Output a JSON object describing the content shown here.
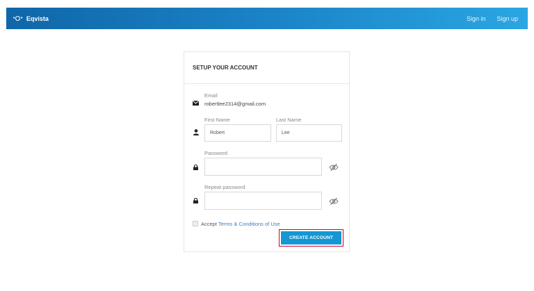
{
  "header": {
    "brand": "Eqvista",
    "nav": {
      "sign_in": "Sign in",
      "sign_up": "Sign up"
    }
  },
  "form": {
    "title": "SETUP YOUR ACCOUNT",
    "email": {
      "label": "Email",
      "value": "robertlee2314@gmail.com"
    },
    "first_name": {
      "label": "First Name",
      "value": "Robert"
    },
    "last_name": {
      "label": "Last Name",
      "value": "Lee"
    },
    "password": {
      "label": "Password",
      "value": ""
    },
    "repeat_password": {
      "label": "Repeat password",
      "value": ""
    },
    "accept": {
      "text": "Accept ",
      "link": "Terms & Conditions of Use"
    },
    "submit_label": "CREATE ACCOUNT"
  },
  "icons": {
    "brand": "eqvista-logo-icon",
    "email": "envelope-icon",
    "name": "user-icon",
    "password": "lock-icon",
    "visibility": "eye-slash-icon"
  },
  "colors": {
    "header_start": "#0f66a8",
    "header_end": "#2aa6e2",
    "button": "#1597d3",
    "highlight": "#d0021b",
    "link": "#3a7fbf"
  }
}
